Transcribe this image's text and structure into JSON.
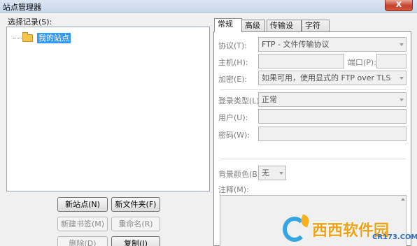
{
  "window": {
    "title": "站点管理器",
    "close_label": "X"
  },
  "left": {
    "select_label": "选择记录(S):",
    "tree": [
      {
        "label": "我的站点",
        "icon": "folder-icon",
        "selected": true
      }
    ],
    "buttons": {
      "new_site": "新站点(N)",
      "new_folder": "新文件夹(F)",
      "new_bookmark": "新建书签(M)",
      "rename": "重命名(R)",
      "delete": "删除(D)",
      "copy": "复制(I)"
    }
  },
  "tabs": [
    {
      "label": "常规",
      "active": true
    },
    {
      "label": "高级",
      "active": false
    },
    {
      "label": "传输设置",
      "active": false
    },
    {
      "label": "字符集",
      "active": false
    }
  ],
  "general": {
    "protocol": {
      "label": "协议(T):",
      "value": "FTP - 文件传输协议"
    },
    "host": {
      "label": "主机(H):",
      "value": ""
    },
    "port": {
      "label": "端口(P):",
      "value": ""
    },
    "encryption": {
      "label": "加密(E):",
      "value": "如果可用，使用显式的 FTP over TLS"
    },
    "logon_type": {
      "label": "登录类型(L):",
      "value": "正常"
    },
    "user": {
      "label": "用户(U):",
      "value": ""
    },
    "password": {
      "label": "密码(W):",
      "value": ""
    },
    "bg_color": {
      "label": "背景颜色(B)",
      "value": "无"
    },
    "comments": {
      "label": "注释(M):",
      "value": ""
    }
  },
  "watermark": {
    "text": "西西软件园",
    "url": "CR173.COM"
  },
  "colors": {
    "selection": "#3399ff",
    "folder": "#f3c34a",
    "close": "#c4412b"
  }
}
